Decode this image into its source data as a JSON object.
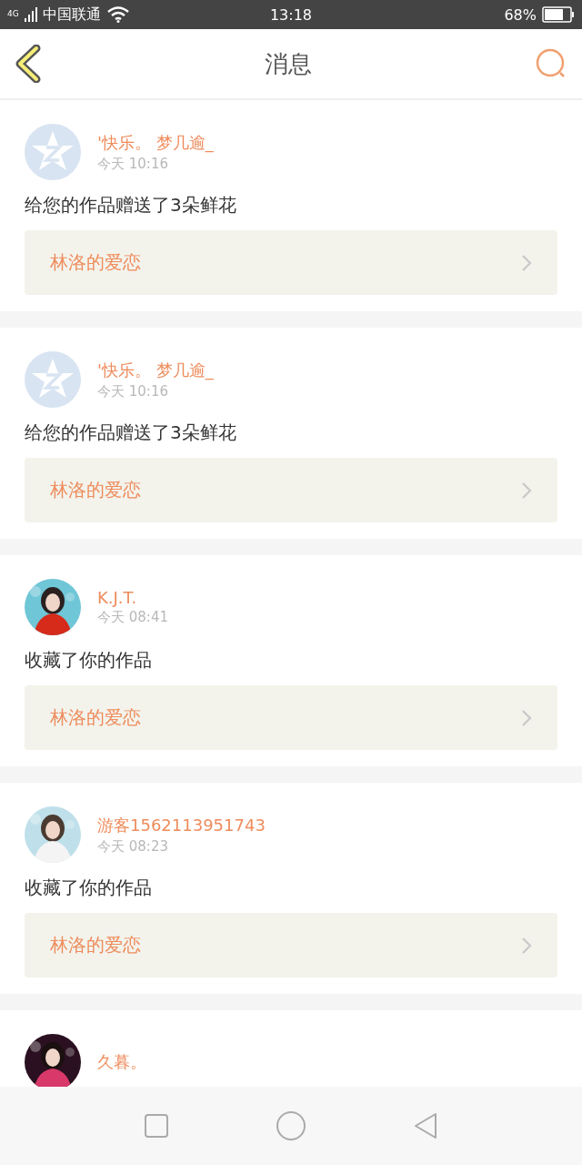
{
  "status_bar": {
    "network": "4G",
    "carrier": "中国联通",
    "time": "13:18",
    "battery": "68%"
  },
  "header": {
    "title": "消息"
  },
  "messages": [
    {
      "avatar": {
        "kind": "default"
      },
      "name": "'快乐。 梦几逾_",
      "time": "今天 10:16",
      "text": "给您的作品赠送了3朵鲜花",
      "work": "林洛的爱恋"
    },
    {
      "avatar": {
        "kind": "default"
      },
      "name": "'快乐。 梦几逾_",
      "time": "今天 10:16",
      "text": "给您的作品赠送了3朵鲜花",
      "work": "林洛的爱恋"
    },
    {
      "name": "K.J.T.",
      "time": "今天 08:41",
      "text": "收藏了你的作品",
      "work": "林洛的爱恋"
    },
    {
      "name": "游客1562113951743",
      "time": "今天 08:23",
      "text": "收藏了你的作品",
      "work": "林洛的爱恋"
    },
    {
      "name": "久暮。"
    }
  ]
}
